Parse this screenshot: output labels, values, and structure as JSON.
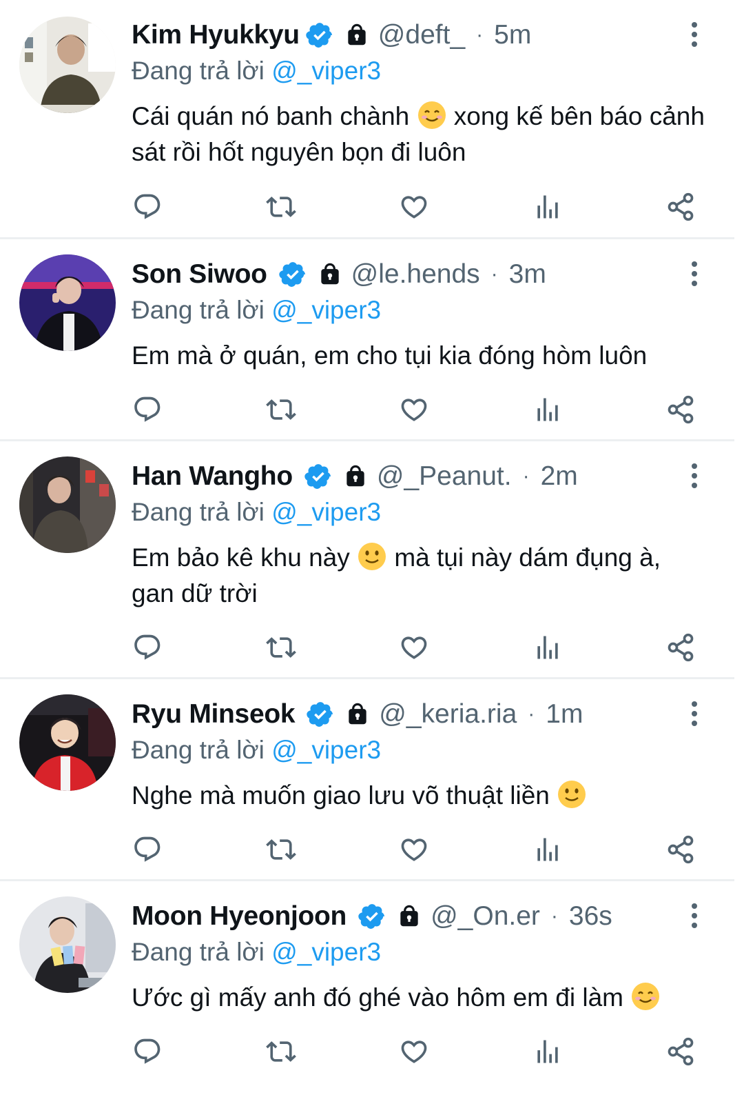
{
  "reply_prefix": "Đang trả lời",
  "colors": {
    "verified": "#1d9bf0",
    "mention": "#1d9bf0",
    "muted": "#536471"
  },
  "tweets": [
    {
      "name": "Kim Hyukkyu",
      "handle": "@deft_",
      "time": "5m",
      "reply_to": "@_viper3",
      "text_parts": [
        "Cái quán nó banh chành ",
        " xong kế bên báo cảnh sát rồi hốt nguyên bọn đi luôn"
      ],
      "emoji": "smiling-face-with-smiling-eyes"
    },
    {
      "name": "Son Siwoo",
      "handle": "@le.hends",
      "time": "3m",
      "reply_to": "@_viper3",
      "text_parts": [
        "Em mà ở quán, em cho tụi kia đóng hòm luôn"
      ],
      "emoji": null
    },
    {
      "name": "Han Wangho",
      "handle": "@_Peanut.",
      "time": "2m",
      "reply_to": "@_viper3",
      "text_parts": [
        "Em bảo kê khu này ",
        " mà tụi này dám đụng à, gan dữ trời"
      ],
      "emoji": "slightly-smiling-face"
    },
    {
      "name": "Ryu Minseok",
      "handle": "@_keria.ria",
      "time": "1m",
      "reply_to": "@_viper3",
      "text_parts": [
        "Nghe mà muốn giao lưu võ thuật liền ",
        ""
      ],
      "emoji": "slightly-smiling-face"
    },
    {
      "name": "Moon Hyeonjoon",
      "handle": "@_On.er",
      "time": "36s",
      "reply_to": "@_viper3",
      "text_parts": [
        "Ước gì mấy anh đó ghé vào hôm em đi làm ",
        ""
      ],
      "emoji": "smiling-face-with-smiling-eyes"
    }
  ]
}
